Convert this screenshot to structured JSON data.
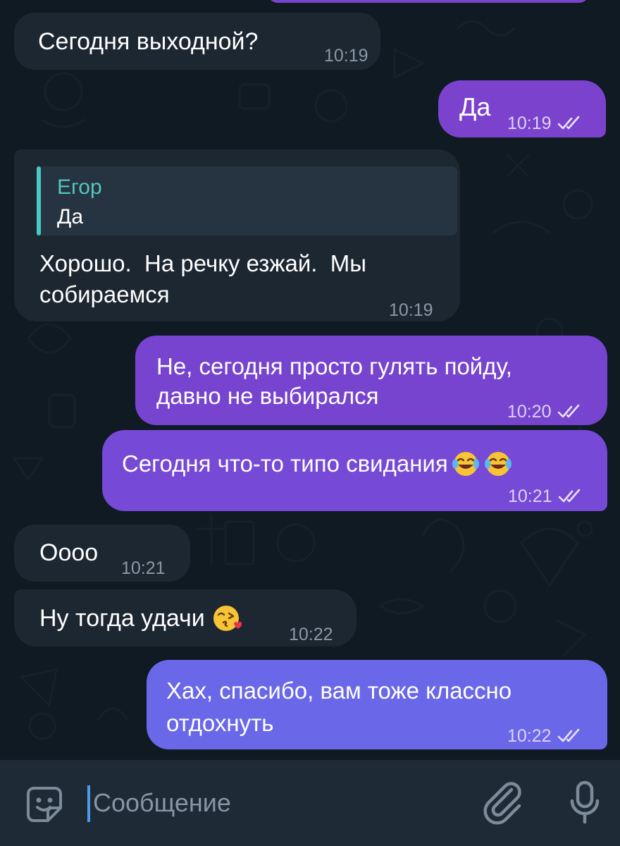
{
  "messages": [
    {
      "dir": "in",
      "text": "Сегодня выходной?",
      "time": "10:19"
    },
    {
      "dir": "out",
      "text": "Да",
      "time": "10:19"
    },
    {
      "dir": "in",
      "reply_name": "Егор",
      "reply_text": "Да",
      "line1": "Хорошо.  На речку езжай.  Мы",
      "line2": "собираемся",
      "time": "10:19"
    },
    {
      "dir": "out",
      "line1": "Не, сегодня просто гулять пойду,",
      "line2": "давно не выбирался",
      "time": "10:20"
    },
    {
      "dir": "out",
      "text": "Сегодня что-то типо свидания",
      "emoji": "laughing-tears-icon",
      "time": "10:21"
    },
    {
      "dir": "in",
      "text": "Оооо",
      "time": "10:21"
    },
    {
      "dir": "in",
      "text": "Ну тогда удачи",
      "emoji": "kiss-face-icon",
      "time": "10:22"
    },
    {
      "dir": "out",
      "line1": "Хах, спасибо, вам тоже классно",
      "line2": "отдохнуть",
      "time": "10:22"
    }
  ],
  "input": {
    "placeholder": "Сообщение"
  },
  "colors": {
    "incoming": "#1d2731",
    "outgoing": "#7b43cd",
    "background": "#0e1621",
    "reply_accent": "#48c8c4"
  }
}
